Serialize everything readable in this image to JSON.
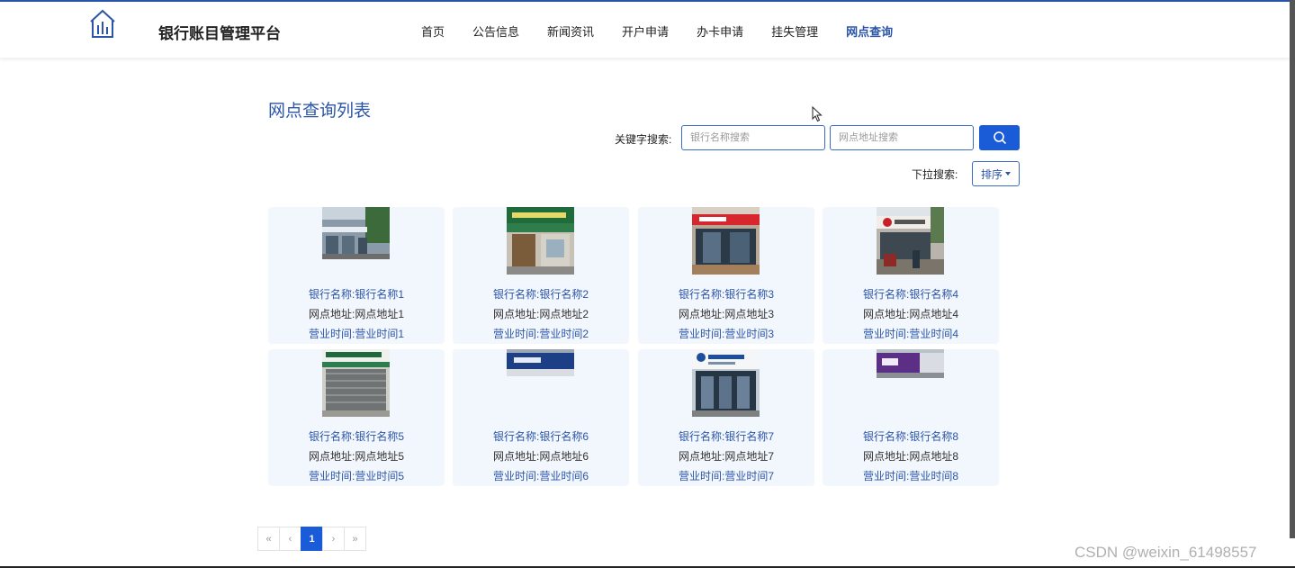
{
  "header": {
    "site_title": "银行账目管理平台",
    "nav": [
      {
        "label": "首页",
        "active": false
      },
      {
        "label": "公告信息",
        "active": false
      },
      {
        "label": "新闻资讯",
        "active": false
      },
      {
        "label": "开户申请",
        "active": false
      },
      {
        "label": "办卡申请",
        "active": false
      },
      {
        "label": "挂失管理",
        "active": false
      },
      {
        "label": "网点查询",
        "active": true
      }
    ]
  },
  "main": {
    "title": "网点查询列表",
    "search": {
      "label": "关键字搜索:",
      "name_placeholder": "银行名称搜索",
      "address_placeholder": "网点地址搜索",
      "button_icon": "search-icon"
    },
    "dropdown": {
      "label": "下拉搜索:",
      "sort_label": "排序"
    },
    "cards": [
      {
        "line1": "银行名称:银行名称1",
        "line2": "网点地址:网点地址1",
        "line3": "营业时间:营业时间1"
      },
      {
        "line1": "银行名称:银行名称2",
        "line2": "网点地址:网点地址2",
        "line3": "营业时间:营业时间2"
      },
      {
        "line1": "银行名称:银行名称3",
        "line2": "网点地址:网点地址3",
        "line3": "营业时间:营业时间3"
      },
      {
        "line1": "银行名称:银行名称4",
        "line2": "网点地址:网点地址4",
        "line3": "营业时间:营业时间4"
      },
      {
        "line1": "银行名称:银行名称5",
        "line2": "网点地址:网点地址5",
        "line3": "营业时间:营业时间5"
      },
      {
        "line1": "银行名称:银行名称6",
        "line2": "网点地址:网点地址6",
        "line3": "营业时间:营业时间6"
      },
      {
        "line1": "银行名称:银行名称7",
        "line2": "网点地址:网点地址7",
        "line3": "营业时间:营业时间7"
      },
      {
        "line1": "银行名称:银行名称8",
        "line2": "网点地址:网点地址8",
        "line3": "营业时间:营业时间8"
      }
    ],
    "pagination": {
      "first": "«",
      "prev": "‹",
      "current": "1",
      "next": "›",
      "last": "»"
    }
  },
  "watermark": "CSDN @weixin_61498557",
  "colors": {
    "accent": "#2b55a8",
    "button": "#1a5bd8",
    "card_bg": "#f2f6fd"
  }
}
